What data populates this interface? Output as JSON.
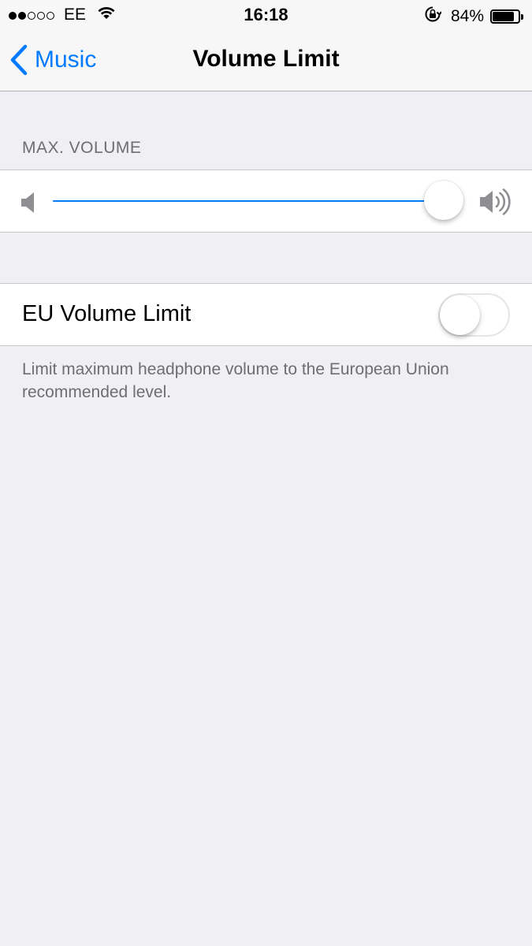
{
  "status_bar": {
    "signal_bars_filled": 2,
    "signal_bars_total": 5,
    "carrier": "EE",
    "time": "16:18",
    "battery_percent": "84%",
    "battery_level": 0.84,
    "icons": [
      "wifi-icon",
      "orientation-lock-icon",
      "battery-icon"
    ]
  },
  "nav": {
    "back_label": "Music",
    "title": "Volume Limit"
  },
  "max_volume": {
    "section_header": "MAX. VOLUME",
    "slider_value": 1.0,
    "icons": [
      "volume-low-icon",
      "volume-high-icon"
    ]
  },
  "eu_limit": {
    "label": "EU Volume Limit",
    "enabled": false,
    "footer": "Limit maximum headphone volume to the European Union recommended level."
  },
  "colors": {
    "accent": "#007aff",
    "background": "#efeff4",
    "secondary_text": "#6d6d72"
  }
}
